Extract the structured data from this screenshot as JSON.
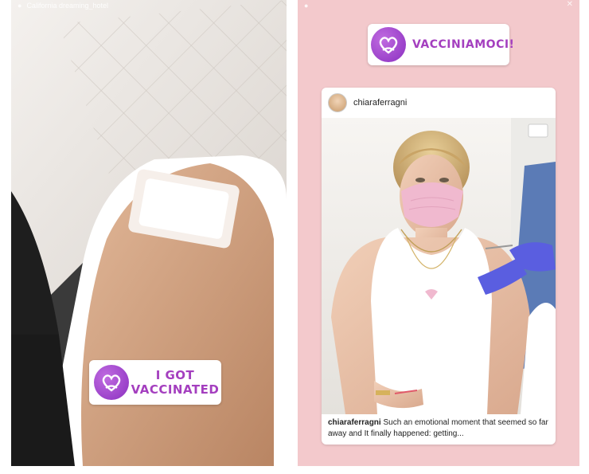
{
  "left_story": {
    "location_text": "California dreaming_hotel",
    "sticker_line1": "I GOT",
    "sticker_line2": "VACCINATED"
  },
  "right_story": {
    "sticker_text": "VACCINIAMOCI!",
    "post": {
      "username": "chiaraferragni",
      "caption_user": "chiaraferragni",
      "caption_text": "Such an emotional moment that seemed so far away and It finally happened: getting..."
    }
  },
  "colors": {
    "story_bg_right": "#f3c9cc",
    "sticker_purple": "#a43fbf",
    "glove_blue": "#5a5ee0",
    "mask_pink": "#f0b9cf"
  },
  "icons": [
    "heart-logo-icon",
    "close-icon"
  ]
}
